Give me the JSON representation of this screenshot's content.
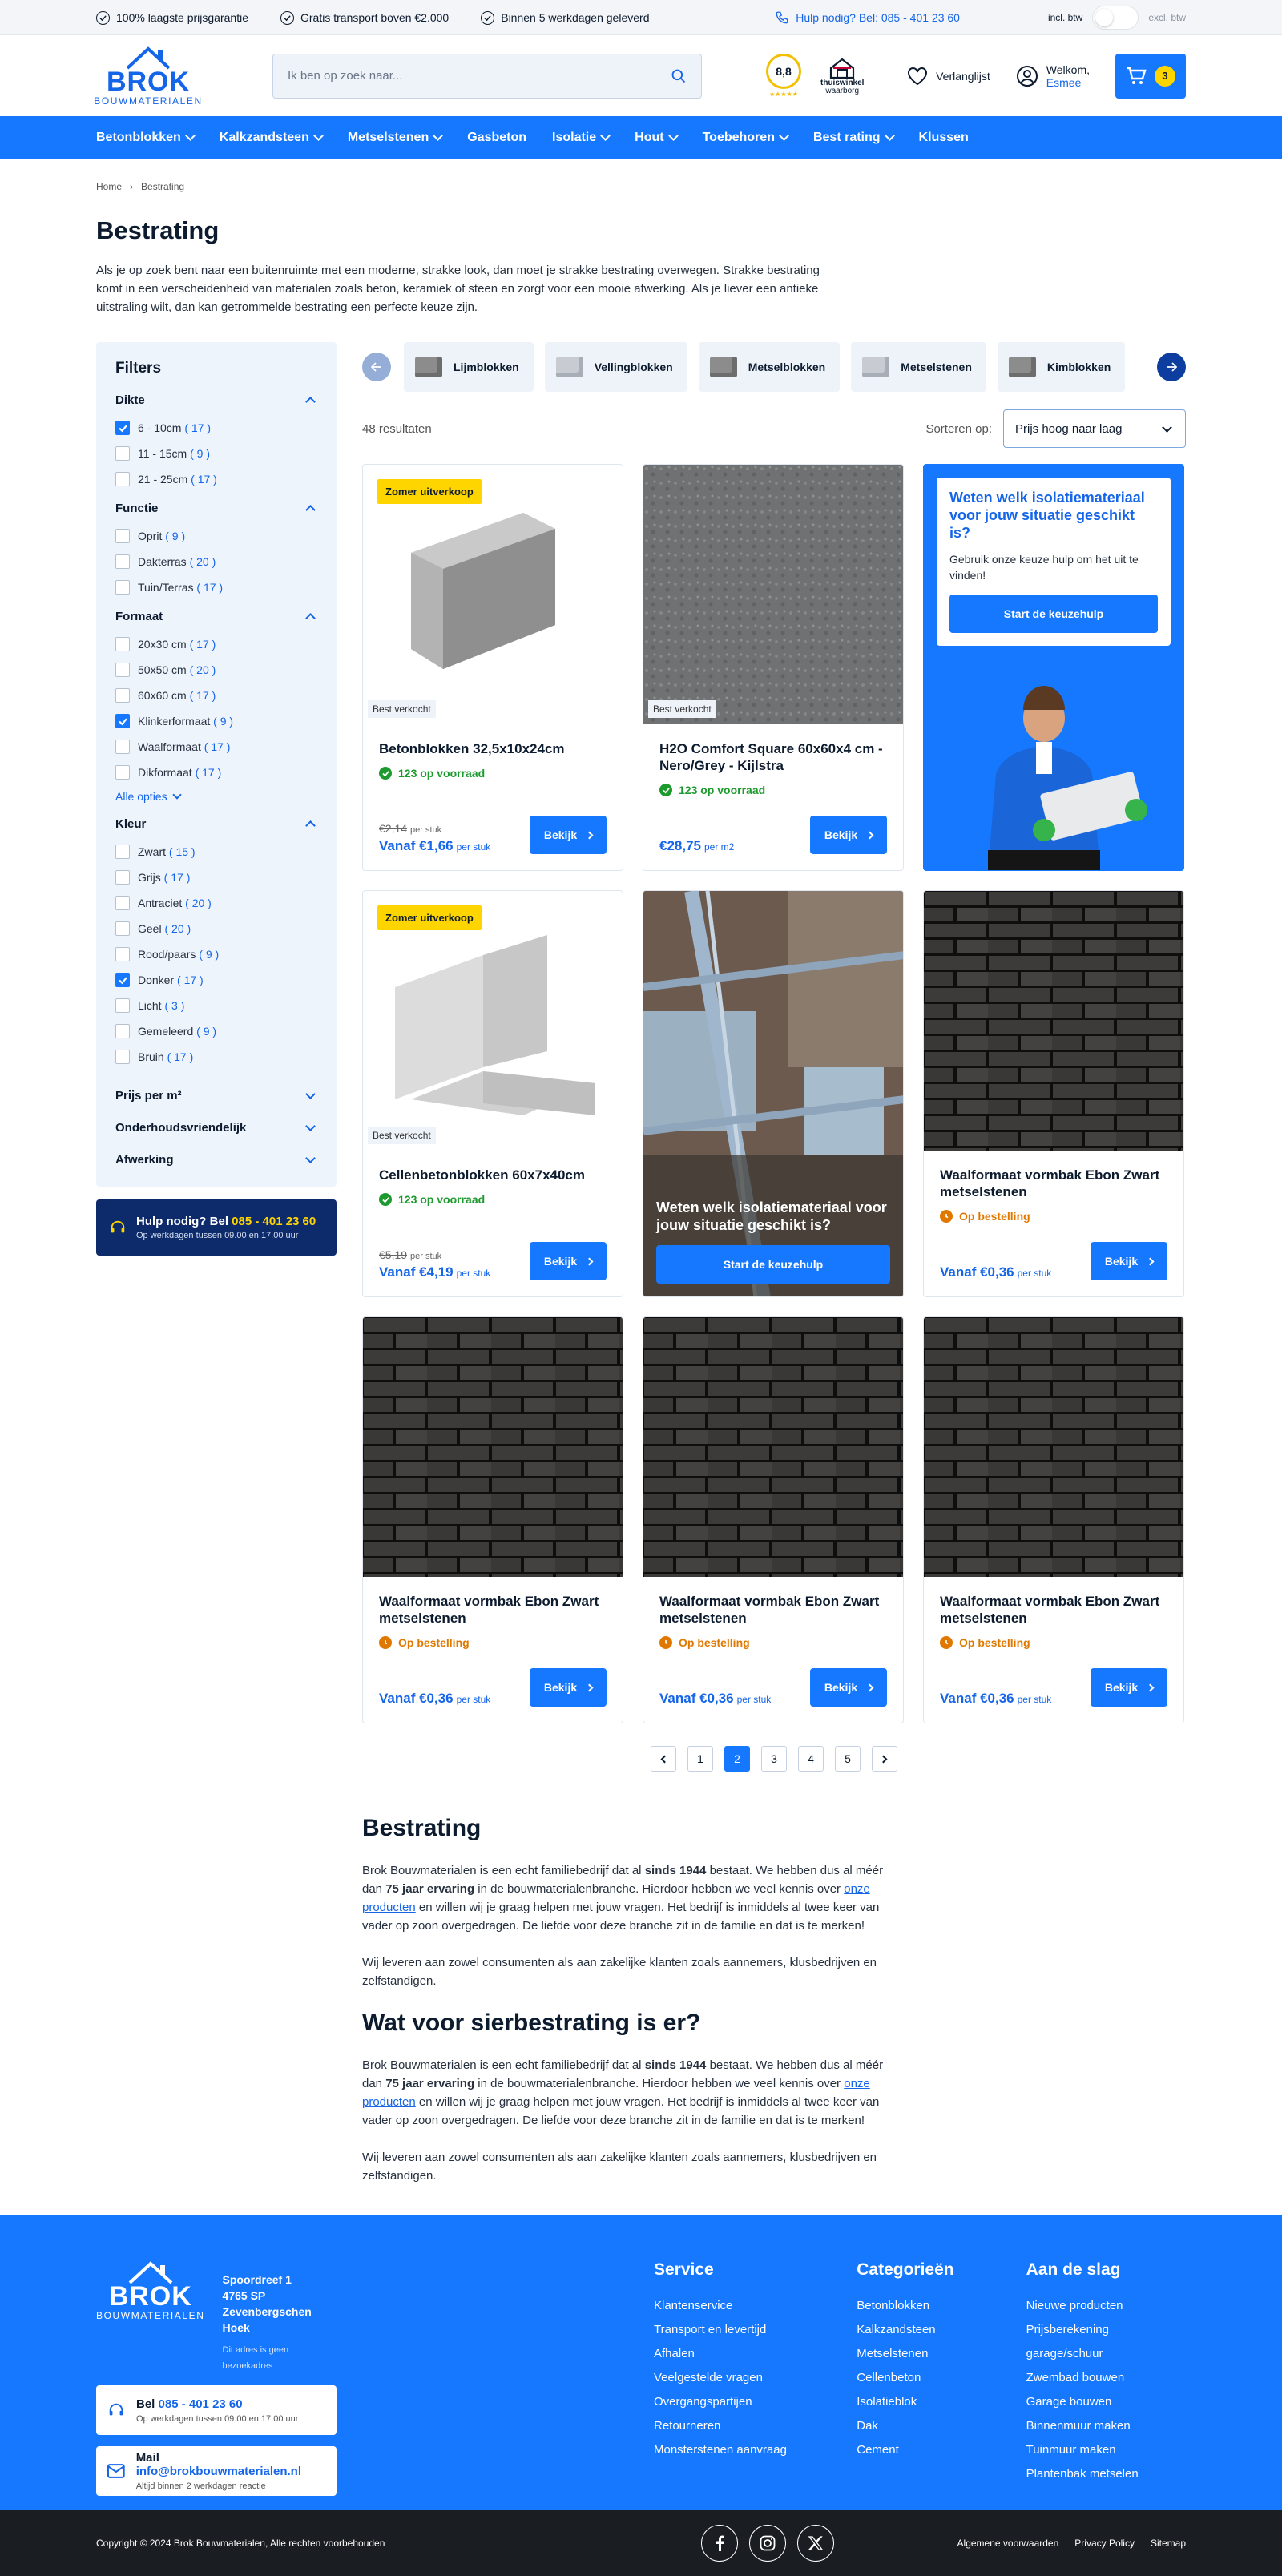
{
  "topbar": {
    "usps": [
      "100% laagste prijsgarantie",
      "Gratis transport boven €2.000",
      "Binnen 5 werkdagen geleverd"
    ],
    "help": "Hulp nodig? Bel: 085 - 401 23 60",
    "btw_on": "incl. btw",
    "btw_off": "excl. btw"
  },
  "header": {
    "logo_name": "BROK",
    "logo_sub": "BOUWMATERIALEN",
    "search_placeholder": "Ik ben op zoek naar...",
    "rating": "8,8",
    "thuiswinkel_1": "thuiswinkel",
    "thuiswinkel_2": "waarborg",
    "wishlist": "Verlanglijst",
    "welcome": "Welkom,",
    "user": "Esmee",
    "cart_count": "3"
  },
  "nav": [
    "Betonblokken",
    "Kalkzandsteen",
    "Metselstenen",
    "Gasbeton",
    "Isolatie",
    "Hout",
    "Toebehoren",
    "Best rating",
    "Klussen"
  ],
  "breadcrumb": [
    "Home",
    "Bestrating"
  ],
  "page": {
    "title": "Bestrating",
    "intro": "Als je op zoek bent naar een buitenruimte met een moderne, strakke look, dan moet je strakke bestrating overwegen. Strakke bestrating komt in een verscheidenheid van materialen zoals beton, keramiek of steen en zorgt voor een mooie afwerking. Als je liever een antieke uitstraling wilt, dan kan getrommelde bestrating een perfecte keuze zijn."
  },
  "filters": {
    "title": "Filters",
    "groups": [
      {
        "name": "Dikte",
        "options": [
          {
            "label": "6 - 10cm",
            "count": "17",
            "checked": true
          },
          {
            "label": "11 - 15cm",
            "count": "9",
            "checked": false
          },
          {
            "label": "21 - 25cm",
            "count": "17",
            "checked": false
          }
        ]
      },
      {
        "name": "Functie",
        "options": [
          {
            "label": "Oprit",
            "count": "9",
            "checked": false
          },
          {
            "label": "Dakterras",
            "count": "20",
            "checked": false
          },
          {
            "label": "Tuin/Terras",
            "count": "17",
            "checked": false
          }
        ]
      },
      {
        "name": "Formaat",
        "options": [
          {
            "label": "20x30 cm",
            "count": "17",
            "checked": false
          },
          {
            "label": "50x50 cm",
            "count": "20",
            "checked": false
          },
          {
            "label": "60x60 cm",
            "count": "17",
            "checked": false
          },
          {
            "label": "Klinkerformaat",
            "count": "9",
            "checked": true
          },
          {
            "label": "Waalformaat",
            "count": "17",
            "checked": false
          },
          {
            "label": "Dikformaat",
            "count": "17",
            "checked": false
          }
        ]
      },
      {
        "name": "Kleur",
        "options": [
          {
            "label": "Zwart",
            "count": "15",
            "checked": false
          },
          {
            "label": "Grijs",
            "count": "17",
            "checked": false
          },
          {
            "label": "Antraciet",
            "count": "20",
            "checked": false
          },
          {
            "label": "Geel",
            "count": "20",
            "checked": false
          },
          {
            "label": "Rood/paars",
            "count": "9",
            "checked": false
          },
          {
            "label": "Donker",
            "count": "17",
            "checked": true
          },
          {
            "label": "Licht",
            "count": "3",
            "checked": false
          },
          {
            "label": "Gemeleerd",
            "count": "9",
            "checked": false
          },
          {
            "label": "Bruin",
            "count": "17",
            "checked": false
          }
        ]
      }
    ],
    "more": "Alle opties",
    "collapsed": [
      "Prijs per m²",
      "Onderhoudsvriendelijk",
      "Afwerking"
    ],
    "help_title": "Hulp nodig? Bel ",
    "help_phone": "085 - 401 23 60",
    "help_sub": "Op werkdagen tussen 09.00 en 17.00 uur"
  },
  "categories": [
    "Lijmblokken",
    "Vellingblokken",
    "Metselblokken",
    "Metselstenen",
    "Kimblokken"
  ],
  "results": {
    "count": "48 resultaten",
    "sort_label": "Sorteren op:",
    "sort_value": "Prijs hoog naar laag"
  },
  "products": [
    {
      "badge": "Zomer uitverkoop",
      "best": "Best verkocht",
      "name": "Betonblokken 32,5x10x24cm",
      "stock": "123 op voorraad",
      "old": "€2,14",
      "old_unit": "per stuk",
      "price": "Vanaf €1,66",
      "unit": "per stuk",
      "button": "Bekijk"
    },
    {
      "best": "Best verkocht",
      "name": "H2O Comfort Square 60x60x4 cm - Nero/Grey - Kijlstra",
      "stock": "123 op voorraad",
      "price": "€28,75",
      "unit": "per m2",
      "button": "Bekijk"
    },
    {
      "badge": "Zomer uitverkoop",
      "best": "Best verkocht",
      "name": "Cellenbetonblokken 60x7x40cm",
      "stock": "123 op voorraad",
      "old": "€5,19",
      "old_unit": "per stuk",
      "price": "Vanaf €4,19",
      "unit": "per stuk",
      "button": "Bekijk"
    },
    {
      "name": "Waalformaat vormbak Ebon Zwart metselstenen",
      "stock": "Op bestelling",
      "price": "Vanaf €0,36",
      "unit": "per stuk",
      "button": "Bekijk"
    },
    {
      "name": "Waalformaat vormbak Ebon Zwart metselstenen",
      "stock": "Op bestelling",
      "price": "Vanaf €0,36",
      "unit": "per stuk",
      "button": "Bekijk"
    },
    {
      "name": "Waalformaat vormbak Ebon Zwart metselstenen",
      "stock": "Op bestelling",
      "price": "Vanaf €0,36",
      "unit": "per stuk",
      "button": "Bekijk"
    },
    {
      "name": "Waalformaat vormbak Ebon Zwart metselstenen",
      "stock": "Op bestelling",
      "price": "Vanaf €0,36",
      "unit": "per stuk",
      "button": "Bekijk"
    }
  ],
  "promo1": {
    "title": "Weten welk isolatiemateriaal voor jouw situatie geschikt is?",
    "text": "Gebruik onze keuze hulp om het uit te vinden!",
    "button": "Start de keuzehulp"
  },
  "promo2": {
    "title": "Weten welk isolatiemateriaal voor jouw situatie geschikt is?",
    "button": "Start de keuzehulp"
  },
  "pagination": [
    "1",
    "2",
    "3",
    "4",
    "5"
  ],
  "seo": {
    "h1": "Bestrating",
    "p1a": "Brok Bouwmaterialen is een echt familiebedrijf dat al ",
    "p1b": "sinds 1944",
    "p1c": " bestaat. We hebben dus al méér dan ",
    "p1d": "75 jaar ervaring",
    "p1e": " in de bouwmaterialenbranche. Hierdoor hebben we veel kennis over ",
    "p1link": "onze producten",
    "p1f": " en willen wij je graag helpen met jouw vragen. Het bedrijf is inmiddels al twee keer van vader op zoon overgedragen. De liefde voor deze branche zit in de familie en dat is te merken!",
    "p2": "Wij leveren aan zowel consumenten als aan zakelijke klanten zoals aannemers, klusbedrijven en zelfstandigen.",
    "h2": "Wat voor sierbestrating is er?",
    "p3c": " bestaat. We hebben dus al méér dan "
  },
  "footer": {
    "street": "Spoordreef 1",
    "city": "4765 SP Zevenbergschen Hoek",
    "note": "Dit adres is geen bezoekadres",
    "call_label": "Bel ",
    "call": "085 - 401 23 60",
    "call_sub": "Op werkdagen tussen 09.00 en 17.00 uur",
    "mail_label": "Mail ",
    "mail": "info@brokbouwmaterialen.nl",
    "mail_sub": "Altijd binnen 2 werkdagen reactie",
    "service_title": "Service",
    "service": [
      "Klantenservice",
      "Transport en levertijd",
      "Afhalen",
      "Veelgestelde vragen",
      "Overgangspartijen",
      "Retourneren",
      "Monsterstenen aanvraag"
    ],
    "cat_title": "Categorieën",
    "cats": [
      "Betonblokken",
      "Kalkzandsteen",
      "Metselstenen",
      "Cellenbeton",
      "Isolatieblok",
      "Dak",
      "Cement"
    ],
    "start_title": "Aan de slag",
    "start": [
      "Nieuwe producten",
      "Prijsberekening garage/schuur",
      "Zwembad bouwen",
      "Garage bouwen",
      "Binnenmuur maken",
      "Tuinmuur maken",
      "Plantenbak metselen"
    ],
    "copyright": "Copyright © 2024 Brok Bouwmaterialen, Alle rechten voorbehouden",
    "links": [
      "Algemene voorwaarden",
      "Privacy Policy",
      "Sitemap"
    ]
  }
}
